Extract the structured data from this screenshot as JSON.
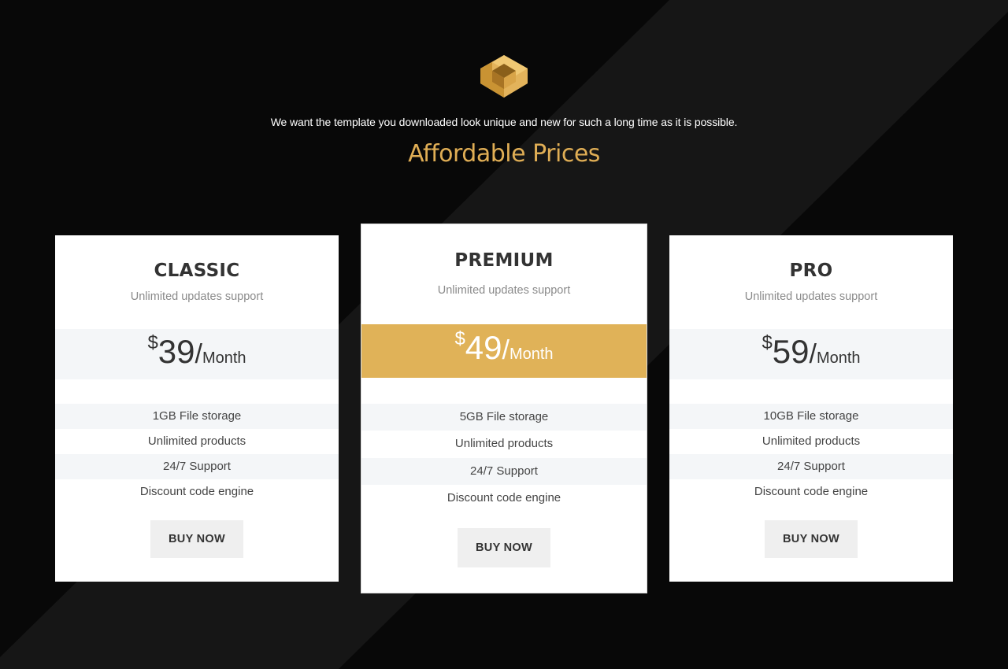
{
  "header": {
    "tagline": "We want the template you downloaded look unique and new for such a long time as it is possible.",
    "title": "Affordable Prices"
  },
  "colors": {
    "accent": "#e0b258",
    "background": "#080808",
    "stripe": "#161616"
  },
  "plans": [
    {
      "name": "CLASSIC",
      "subtitle": "Unlimited updates support",
      "currency": "$",
      "price": "39",
      "slash": "/",
      "period": "Month",
      "features": [
        "1GB File storage",
        "Unlimited products",
        "24/7 Support",
        "Discount code engine"
      ],
      "button": "BUY NOW"
    },
    {
      "name": "PREMIUM",
      "subtitle": "Unlimited updates support",
      "currency": "$",
      "price": "49",
      "slash": "/",
      "period": "Month",
      "features": [
        "5GB File storage",
        "Unlimited products",
        "24/7 Support",
        "Discount code engine"
      ],
      "button": "BUY NOW"
    },
    {
      "name": "PRO",
      "subtitle": "Unlimited updates support",
      "currency": "$",
      "price": "59",
      "slash": "/",
      "period": "Month",
      "features": [
        "10GB File storage",
        "Unlimited products",
        "24/7 Support",
        "Discount code engine"
      ],
      "button": "BUY NOW"
    }
  ]
}
